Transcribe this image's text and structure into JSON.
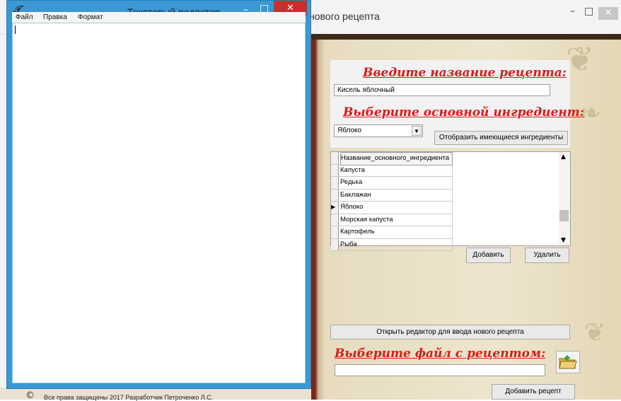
{
  "background_window": {
    "title": "нового рецепта",
    "minimize_glyph": "–",
    "maximize_glyph": "□",
    "close_glyph": "✕"
  },
  "form": {
    "recipe_name_heading": "Введите название рецепта:",
    "recipe_name_value": "Кисель яблочный",
    "main_ingredient_heading": "Выберите основной ингредиент:",
    "main_ingredient_selected": "Яблоко",
    "show_ingredients_button": "Отобразить имеющиеся ингредиенты",
    "grid": {
      "column_header": "Название_основного_ингредиента",
      "rows": [
        "Капуста",
        "Редька",
        "Баклажан",
        "Яблоко",
        "Морская капуста",
        "Картофель",
        "Рыба"
      ],
      "current_row_marker": "▶"
    },
    "add_button": "Добавить",
    "delete_button": "Удалить",
    "open_editor_button": "Открыть редактор для ввода нового рецепта",
    "choose_file_heading": "Выберите файл с рецептом:",
    "file_path_value": "",
    "add_recipe_button": "Добавить рецепт",
    "copyright": "Все права защищены 2017 Разработчик Петроченко Л.С."
  },
  "editor_window": {
    "title": "Текстовый редактор",
    "menu": [
      "Файл",
      "Правка",
      "Формат"
    ],
    "content": "",
    "minimize_glyph": "–",
    "maximize_glyph": "□",
    "close_glyph": "✕"
  },
  "colors": {
    "heading_red": "#e01818",
    "editor_frame": "#3b98d4",
    "close_red": "#c6312a"
  },
  "icons": [
    "notepad-app-icon",
    "open-folder-icon",
    "scroll-up-icon",
    "scroll-down-icon",
    "combo-dropdown-icon"
  ]
}
